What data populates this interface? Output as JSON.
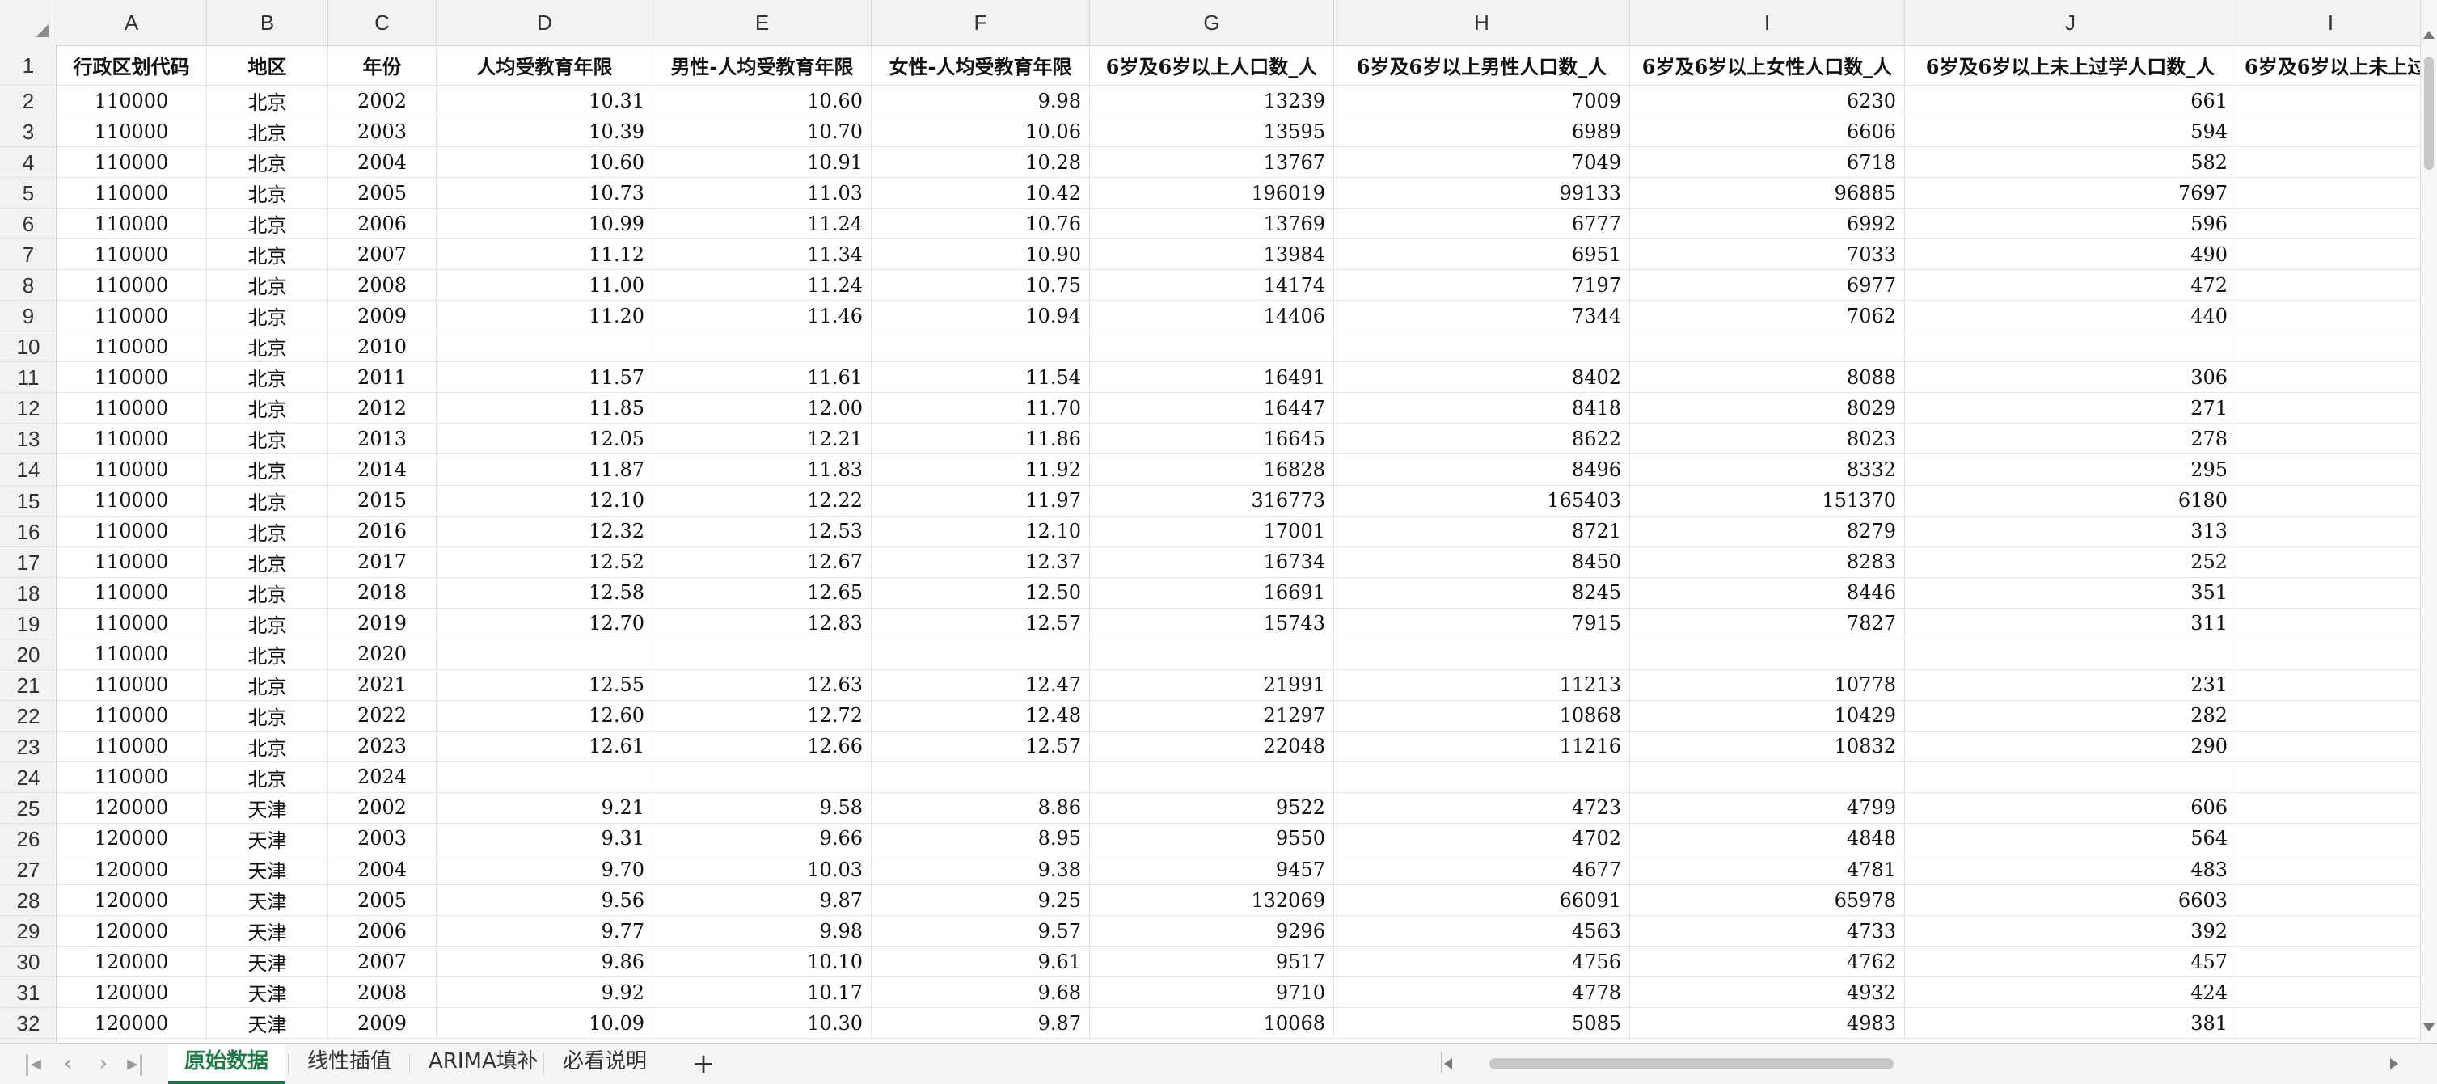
{
  "columns": [
    "A",
    "B",
    "C",
    "D",
    "E",
    "F",
    "G",
    "H",
    "I",
    "J",
    "I"
  ],
  "headers": [
    "行政区划代码",
    "地区",
    "年份",
    "人均受教育年限",
    "男性-人均受教育年限",
    "女性-人均受教育年限",
    "6岁及6岁以上人口数_人",
    "6岁及6岁以上男性人口数_人",
    "6岁及6岁以上女性人口数_人",
    "6岁及6岁以上未上过学人口数_人",
    "6岁及6岁以上未上过"
  ],
  "rows": [
    {
      "n": "2",
      "v": [
        "110000",
        "北京",
        "2002",
        "10.31",
        "10.60",
        "9.98",
        "13239",
        "7009",
        "6230",
        "661"
      ]
    },
    {
      "n": "3",
      "v": [
        "110000",
        "北京",
        "2003",
        "10.39",
        "10.70",
        "10.06",
        "13595",
        "6989",
        "6606",
        "594"
      ]
    },
    {
      "n": "4",
      "v": [
        "110000",
        "北京",
        "2004",
        "10.60",
        "10.91",
        "10.28",
        "13767",
        "7049",
        "6718",
        "582"
      ]
    },
    {
      "n": "5",
      "v": [
        "110000",
        "北京",
        "2005",
        "10.73",
        "11.03",
        "10.42",
        "196019",
        "99133",
        "96885",
        "7697"
      ]
    },
    {
      "n": "6",
      "v": [
        "110000",
        "北京",
        "2006",
        "10.99",
        "11.24",
        "10.76",
        "13769",
        "6777",
        "6992",
        "596"
      ]
    },
    {
      "n": "7",
      "v": [
        "110000",
        "北京",
        "2007",
        "11.12",
        "11.34",
        "10.90",
        "13984",
        "6951",
        "7033",
        "490"
      ]
    },
    {
      "n": "8",
      "v": [
        "110000",
        "北京",
        "2008",
        "11.00",
        "11.24",
        "10.75",
        "14174",
        "7197",
        "6977",
        "472"
      ]
    },
    {
      "n": "9",
      "v": [
        "110000",
        "北京",
        "2009",
        "11.20",
        "11.46",
        "10.94",
        "14406",
        "7344",
        "7062",
        "440"
      ]
    },
    {
      "n": "10",
      "v": [
        "110000",
        "北京",
        "2010",
        "",
        "",
        "",
        "",
        "",
        "",
        ""
      ]
    },
    {
      "n": "11",
      "v": [
        "110000",
        "北京",
        "2011",
        "11.57",
        "11.61",
        "11.54",
        "16491",
        "8402",
        "8088",
        "306"
      ]
    },
    {
      "n": "12",
      "v": [
        "110000",
        "北京",
        "2012",
        "11.85",
        "12.00",
        "11.70",
        "16447",
        "8418",
        "8029",
        "271"
      ]
    },
    {
      "n": "13",
      "v": [
        "110000",
        "北京",
        "2013",
        "12.05",
        "12.21",
        "11.86",
        "16645",
        "8622",
        "8023",
        "278"
      ]
    },
    {
      "n": "14",
      "v": [
        "110000",
        "北京",
        "2014",
        "11.87",
        "11.83",
        "11.92",
        "16828",
        "8496",
        "8332",
        "295"
      ]
    },
    {
      "n": "15",
      "v": [
        "110000",
        "北京",
        "2015",
        "12.10",
        "12.22",
        "11.97",
        "316773",
        "165403",
        "151370",
        "6180"
      ]
    },
    {
      "n": "16",
      "v": [
        "110000",
        "北京",
        "2016",
        "12.32",
        "12.53",
        "12.10",
        "17001",
        "8721",
        "8279",
        "313"
      ]
    },
    {
      "n": "17",
      "v": [
        "110000",
        "北京",
        "2017",
        "12.52",
        "12.67",
        "12.37",
        "16734",
        "8450",
        "8283",
        "252"
      ]
    },
    {
      "n": "18",
      "v": [
        "110000",
        "北京",
        "2018",
        "12.58",
        "12.65",
        "12.50",
        "16691",
        "8245",
        "8446",
        "351"
      ]
    },
    {
      "n": "19",
      "v": [
        "110000",
        "北京",
        "2019",
        "12.70",
        "12.83",
        "12.57",
        "15743",
        "7915",
        "7827",
        "311"
      ]
    },
    {
      "n": "20",
      "v": [
        "110000",
        "北京",
        "2020",
        "",
        "",
        "",
        "",
        "",
        "",
        ""
      ]
    },
    {
      "n": "21",
      "v": [
        "110000",
        "北京",
        "2021",
        "12.55",
        "12.63",
        "12.47",
        "21991",
        "11213",
        "10778",
        "231"
      ]
    },
    {
      "n": "22",
      "v": [
        "110000",
        "北京",
        "2022",
        "12.60",
        "12.72",
        "12.48",
        "21297",
        "10868",
        "10429",
        "282"
      ]
    },
    {
      "n": "23",
      "v": [
        "110000",
        "北京",
        "2023",
        "12.61",
        "12.66",
        "12.57",
        "22048",
        "11216",
        "10832",
        "290"
      ]
    },
    {
      "n": "24",
      "v": [
        "110000",
        "北京",
        "2024",
        "",
        "",
        "",
        "",
        "",
        "",
        ""
      ]
    },
    {
      "n": "25",
      "v": [
        "120000",
        "天津",
        "2002",
        "9.21",
        "9.58",
        "8.86",
        "9522",
        "4723",
        "4799",
        "606"
      ]
    },
    {
      "n": "26",
      "v": [
        "120000",
        "天津",
        "2003",
        "9.31",
        "9.66",
        "8.95",
        "9550",
        "4702",
        "4848",
        "564"
      ]
    },
    {
      "n": "27",
      "v": [
        "120000",
        "天津",
        "2004",
        "9.70",
        "10.03",
        "9.38",
        "9457",
        "4677",
        "4781",
        "483"
      ]
    },
    {
      "n": "28",
      "v": [
        "120000",
        "天津",
        "2005",
        "9.56",
        "9.87",
        "9.25",
        "132069",
        "66091",
        "65978",
        "6603"
      ]
    },
    {
      "n": "29",
      "v": [
        "120000",
        "天津",
        "2006",
        "9.77",
        "9.98",
        "9.57",
        "9296",
        "4563",
        "4733",
        "392"
      ]
    },
    {
      "n": "30",
      "v": [
        "120000",
        "天津",
        "2007",
        "9.86",
        "10.10",
        "9.61",
        "9517",
        "4756",
        "4762",
        "457"
      ]
    },
    {
      "n": "31",
      "v": [
        "120000",
        "天津",
        "2008",
        "9.92",
        "10.17",
        "9.68",
        "9710",
        "4778",
        "4932",
        "424"
      ]
    },
    {
      "n": "32",
      "v": [
        "120000",
        "天津",
        "2009",
        "10.09",
        "10.30",
        "9.87",
        "10068",
        "5085",
        "4983",
        "381"
      ]
    }
  ],
  "tabs": [
    "原始数据",
    "线性插值",
    "ARIMA填补",
    "必看说明"
  ],
  "active_tab": 0,
  "add_tab_label": "+",
  "colors": {
    "accent": "#1e7b45",
    "header_bg": "#f2f2f2",
    "grid_line": "#e3e3e3"
  }
}
